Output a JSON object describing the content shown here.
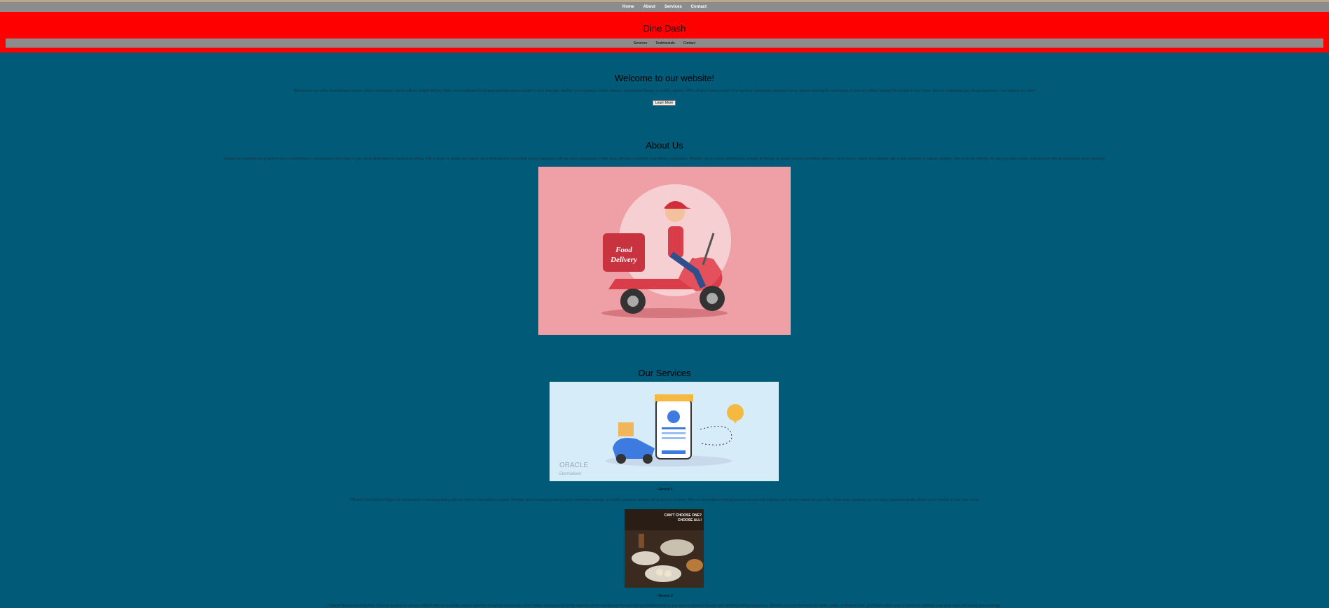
{
  "topnav": {
    "items": [
      "Home",
      "About",
      "Services",
      "Contact"
    ]
  },
  "header": {
    "brand": "Dine Dash",
    "subnav": [
      "Services",
      "Testimonials",
      "Contact"
    ]
  },
  "welcome": {
    "title": "Welcome to our website!",
    "text": "\"Welcome to our online food delivery service, where convenience meets culinary delight! At Dine Dash, we're dedicated to bringing delicious meals straight to your doorstep, whether you're craving comfort classics, international flavors, or healthy options. With a diverse menu curated from top local restaurants, ordering from us means savoring the best flavors of your city without leaving the comfort of your home. Join us in elevating your dining experience, one delivery at a time!\"",
    "button": "Learn More"
  },
  "about": {
    "title": "About Us",
    "text": "\"Inspired by a passion for great food and a commitment to convenience, Dine Dash is your go-to destination for hassle-free dining. With a focus on quality and variety, we're dedicated to connecting hungry customers with top-notch restaurants in their area, offering a seamless food delivery experience. Whether you're a busy professional, a family on-the-go, or simply craving something delicious, we're here to satisfy your appetite with a wide selection of culinary delights. Join us as we redefine the way you enjoy meals, making every bite an experience worth savoring.\"",
    "image_text": [
      "Food",
      "Delivery"
    ]
  },
  "services": {
    "title": "Our Services",
    "image_text": [
      "ORACLE",
      "Eterniafood"
    ],
    "service1": {
      "caption": "- Service 1",
      "text": "Efficient Food Delivery:Enjoy the convenience of doorstep dining with our efficient food delivery service. Whether you're craving gourmet cuisine, comforting classics, or health-conscious options, we've got you covered. With our streamlined ordering process and prompt delivery, your favorite meals are just a few clicks away, ensuring you can enjoy restaurant-quality dishes in the comfort of your own home."
    },
    "food_image_text": [
      "CAN'T CHOOSE ONE?",
      "CHOOSE ALL!"
    ],
    "service2": {
      "caption": "- Service 2",
      "text": "Curated Restaurant Selection: Discover a world of culinary delights with our carefully curated selection of partner restaurants. From hidden local gems to trendy eateries, we've handpicked the best dining establishments in your area to ensure a diverse and satisfying dining experience. Whether you're in the mood for Italian, Asian, or Mexican fare, you'll find a wide array of options to tantalize your taste buds and satisfy your cravings."
    }
  }
}
